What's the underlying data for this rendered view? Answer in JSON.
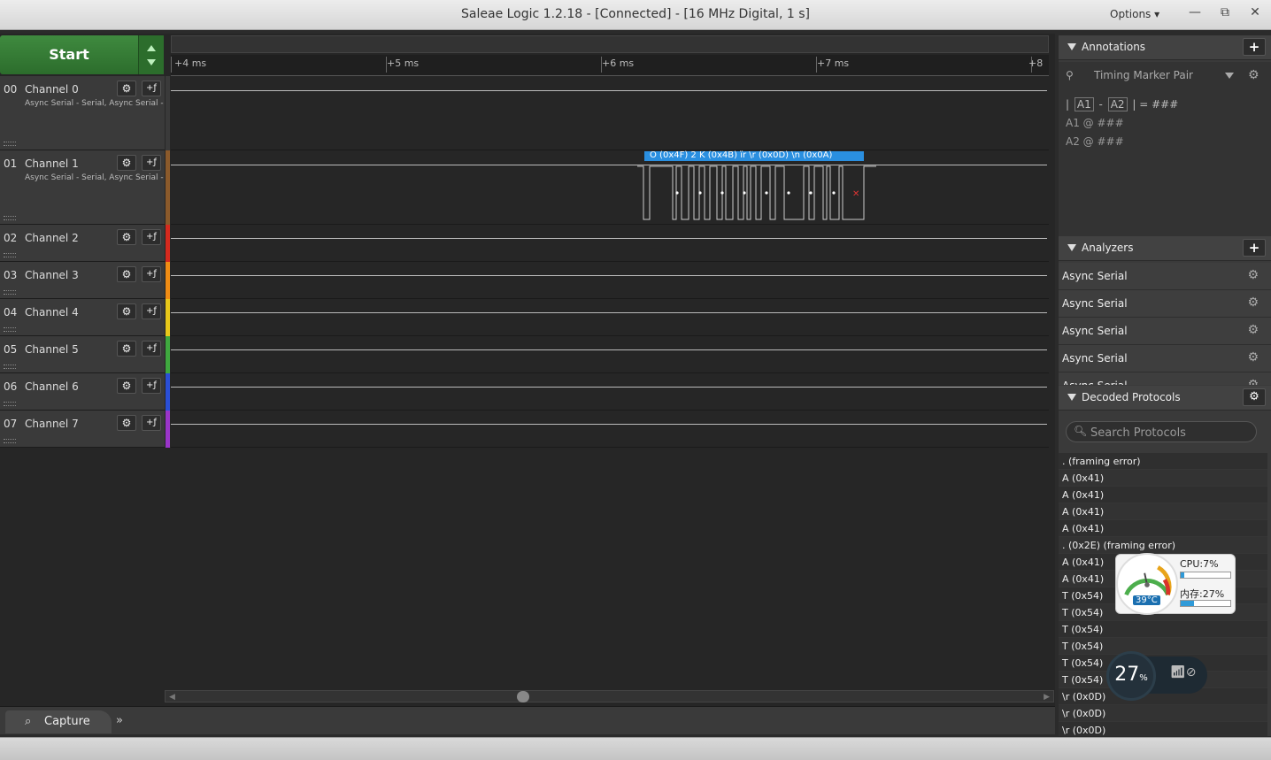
{
  "window": {
    "title": "Saleae Logic 1.2.18 - [Connected] - [16 MHz Digital, 1 s]",
    "options_label": "Options ▾",
    "minimize": "—",
    "restore": "⧉",
    "close": "✕"
  },
  "toolbar": {
    "start_label": "Start"
  },
  "ruler": {
    "ticks": [
      "+4 ms",
      "+5 ms",
      "+6 ms",
      "+7 ms",
      "+8"
    ]
  },
  "channels": [
    {
      "num": "00",
      "name": "Channel 0",
      "sub": "Async Serial - Serial, Async Serial - Serial",
      "color": "#3a3a3a"
    },
    {
      "num": "01",
      "name": "Channel 1",
      "sub": "Async Serial - Serial, Async Serial - Serial",
      "color": "#8b5a2b"
    },
    {
      "num": "02",
      "name": "Channel 2",
      "sub": "",
      "color": "#d62a1e"
    },
    {
      "num": "03",
      "name": "Channel 3",
      "sub": "",
      "color": "#f08c14"
    },
    {
      "num": "04",
      "name": "Channel 4",
      "sub": "",
      "color": "#e8c81a"
    },
    {
      "num": "05",
      "name": "Channel 5",
      "sub": "",
      "color": "#3fa83f"
    },
    {
      "num": "06",
      "name": "Channel 6",
      "sub": "",
      "color": "#2a4fd6"
    },
    {
      "num": "07",
      "name": "Channel 7",
      "sub": "",
      "color": "#9a35c8"
    }
  ],
  "decode_bubble": {
    "text": "O (0x4F)  2  K (0x4B)  їr \\r (0x0D)     \\n (0x0A)",
    "color": "#2a8fe0"
  },
  "bottom": {
    "capture_label": "Capture",
    "more": "»"
  },
  "annotations": {
    "title": "Annotations",
    "marker": "Timing Marker Pair",
    "line1_pre": "|",
    "line1_a1": "A1",
    "line1_mid": "-",
    "line1_a2": "A2",
    "line1_post": "|  =  ###",
    "line2": "A1  @  ###",
    "line3": "A2  @  ###"
  },
  "analyzers": {
    "title": "Analyzers",
    "items": [
      "Async Serial",
      "Async Serial",
      "Async Serial",
      "Async Serial",
      "Async Serial"
    ]
  },
  "decoded": {
    "title": "Decoded Protocols",
    "search_placeholder": "Search Protocols",
    "items": [
      ". (framing error)",
      "A (0x41)",
      "A (0x41)",
      "A (0x41)",
      "A (0x41)",
      ". (0x2E) (framing error)",
      "A (0x41)",
      "A (0x41)",
      "T (0x54)",
      "T (0x54)",
      "T (0x54)",
      "T (0x54)",
      "T (0x54)",
      "T (0x54)",
      "\\r (0x0D)",
      "\\r (0x0D)",
      "\\r (0x0D)"
    ]
  },
  "gadget": {
    "temp": "39°C",
    "cpu": "CPU:7%",
    "cpu_pct": 7,
    "mem": "内存:27%",
    "mem_pct": 27
  },
  "net": {
    "pct": "27",
    "unit": "%"
  }
}
